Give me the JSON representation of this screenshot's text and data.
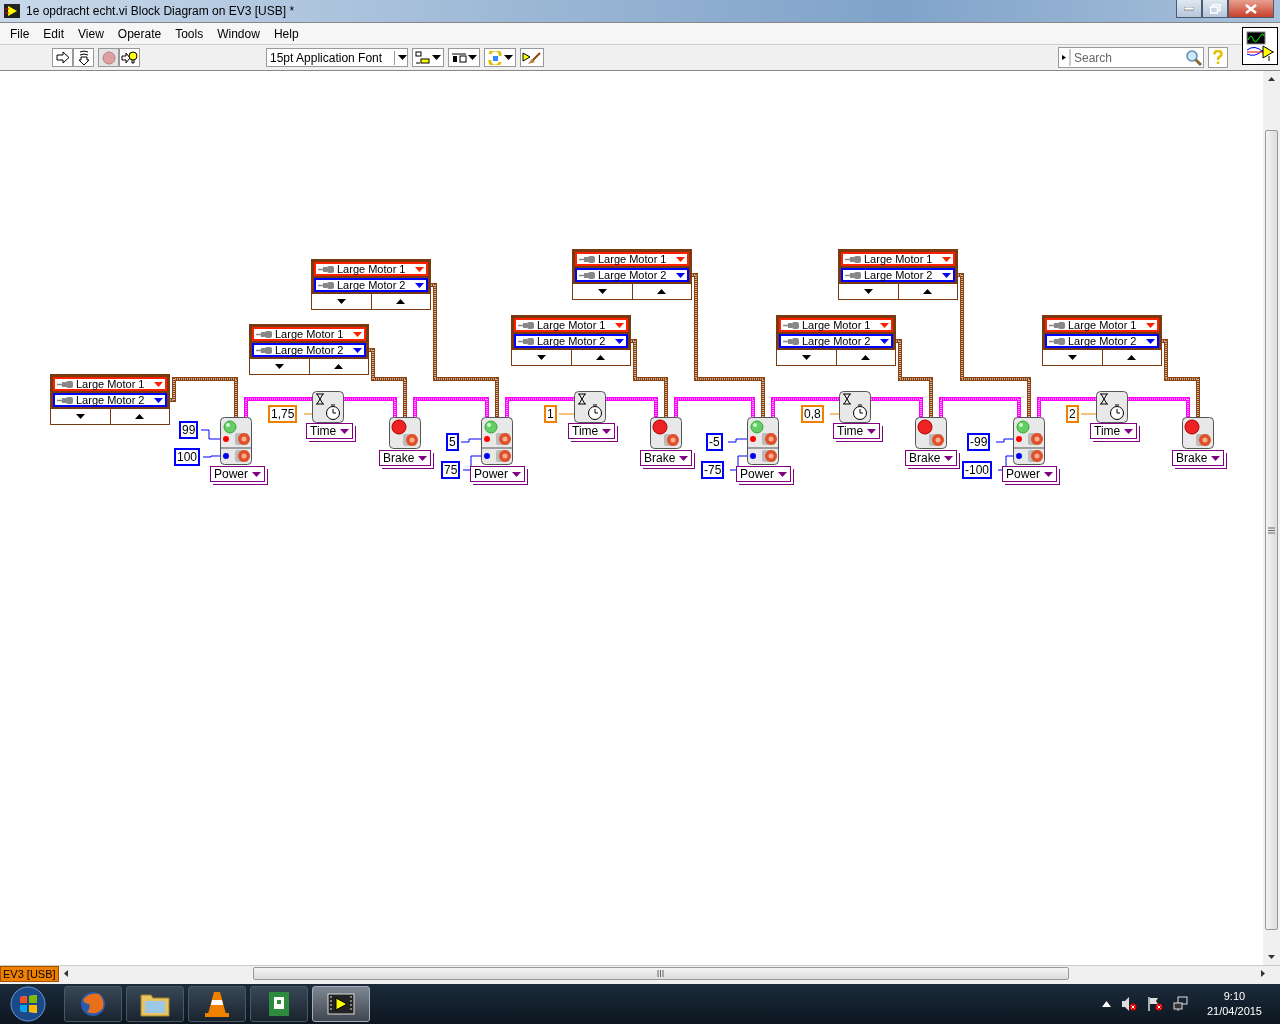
{
  "window": {
    "title": "1e opdracht echt.vi Block Diagram on EV3 [USB] *"
  },
  "menu": [
    "File",
    "Edit",
    "View",
    "Operate",
    "Tools",
    "Window",
    "Help"
  ],
  "toolbar": {
    "font": "15pt Application Font",
    "buttons": [
      {
        "kind": "run",
        "disabled": false
      },
      {
        "kind": "run-continuous",
        "disabled": false
      },
      {
        "kind": "abort",
        "disabled": true
      },
      {
        "kind": "highlight",
        "disabled": false
      }
    ]
  },
  "search": {
    "placeholder": "Search"
  },
  "diagram": {
    "selectors": [
      {
        "ports": [
          "Large Motor 1",
          "Large Motor 2"
        ]
      },
      {
        "ports": [
          "Large Motor 1",
          "Large Motor 2"
        ]
      },
      {
        "ports": [
          "Large Motor 1",
          "Large Motor 2"
        ]
      },
      {
        "ports": [
          "Large Motor 1",
          "Large Motor 2"
        ]
      },
      {
        "ports": [
          "Large Motor 1",
          "Large Motor 2"
        ]
      },
      {
        "ports": [
          "Large Motor 1",
          "Large Motor 2"
        ]
      },
      {
        "ports": [
          "Large Motor 1",
          "Large Motor 2"
        ]
      },
      {
        "ports": [
          "Large Motor 1",
          "Large Motor 2"
        ]
      }
    ],
    "blocks": [
      {
        "kind": "motor",
        "mode": "Power",
        "inputs": [
          "99",
          "100"
        ]
      },
      {
        "kind": "wait",
        "mode": "Time",
        "inputs": [
          "1,75"
        ]
      },
      {
        "kind": "brake",
        "mode": "Brake"
      },
      {
        "kind": "motor",
        "mode": "Power",
        "inputs": [
          "5",
          "75"
        ]
      },
      {
        "kind": "wait",
        "mode": "Time",
        "inputs": [
          "1"
        ]
      },
      {
        "kind": "brake",
        "mode": "Brake"
      },
      {
        "kind": "motor",
        "mode": "Power",
        "inputs": [
          "-5",
          "-75"
        ]
      },
      {
        "kind": "wait",
        "mode": "Time",
        "inputs": [
          "0,8"
        ]
      },
      {
        "kind": "brake",
        "mode": "Brake"
      },
      {
        "kind": "motor",
        "mode": "Power",
        "inputs": [
          "-99",
          "-100"
        ]
      },
      {
        "kind": "wait",
        "mode": "Time",
        "inputs": [
          "2"
        ]
      },
      {
        "kind": "brake",
        "mode": "Brake"
      }
    ]
  },
  "status": {
    "target": "EV3 [USB]"
  },
  "taskbar": {
    "apps": [
      {
        "kind": "browser",
        "selected": false
      },
      {
        "kind": "folder",
        "selected": false
      },
      {
        "kind": "cone",
        "selected": false
      },
      {
        "kind": "document",
        "selected": false
      },
      {
        "kind": "video",
        "selected": true
      }
    ],
    "time": "9:10",
    "date": "21/04/2015"
  }
}
